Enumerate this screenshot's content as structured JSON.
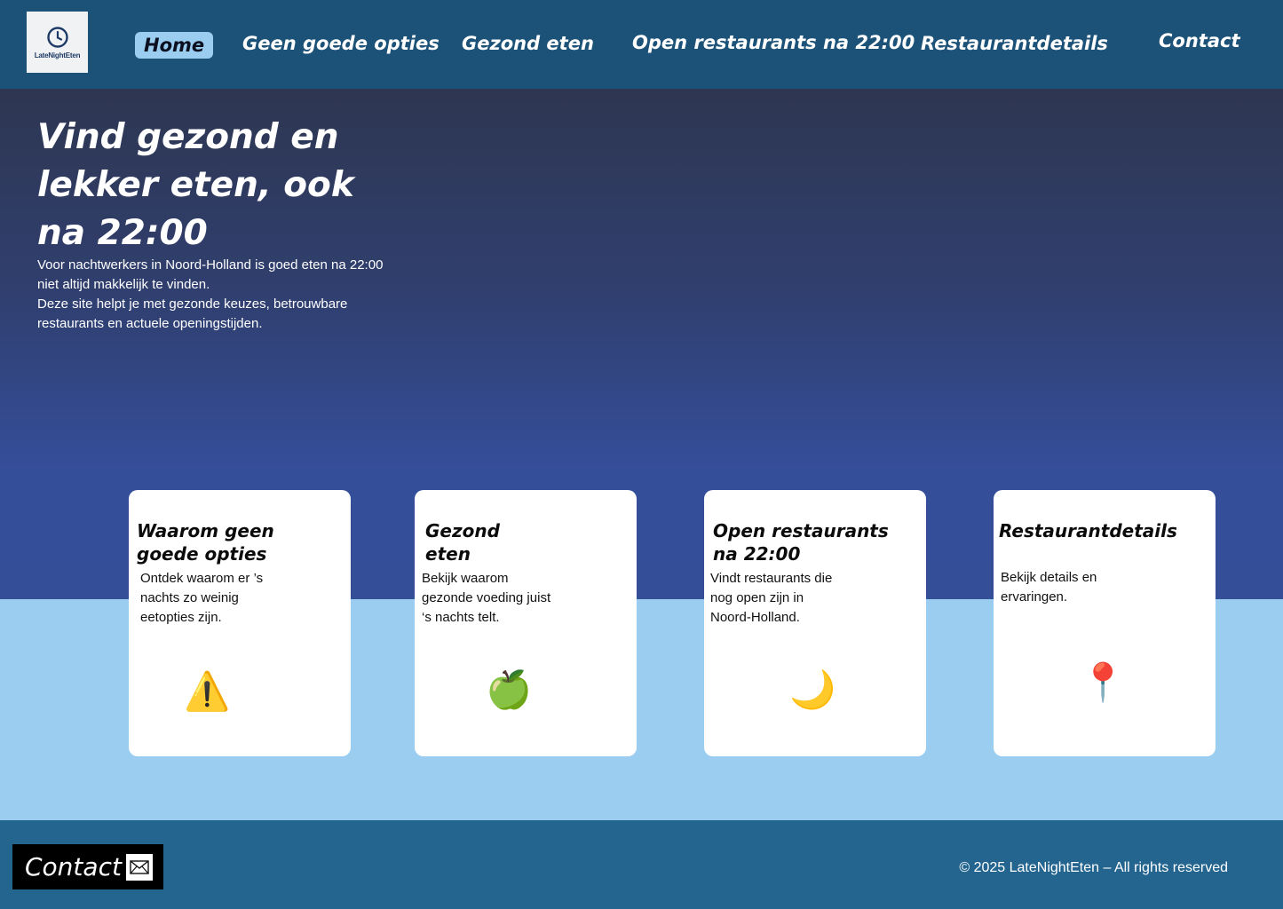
{
  "logo": {
    "text": "LateNightEten",
    "icon": "clock-icon"
  },
  "nav": {
    "home": "Home",
    "geen_goede_opties": "Geen goede opties",
    "gezond_eten": "Gezond eten",
    "open_restaurants": "Open restaurants na 22:00",
    "restaurantdetails": "Restaurantdetails",
    "contact": "Contact"
  },
  "hero": {
    "title": "Vind gezond en lekker eten, ook na 22:00",
    "text_1": "Voor nachtwerkers in Noord-Holland is goed eten na 22:00 niet altijd makkelijk te vinden.",
    "text_2": "Deze site helpt je met gezonde keuzes, betrouwbare restaurants en actuele openingstijden."
  },
  "cards": [
    {
      "title": "Waarom geen goede opties",
      "text": "Ontdek waarom er ’s nachts zo weinig eetopties zijn.",
      "icon": "⚠️",
      "icon_name": "warning-icon"
    },
    {
      "title": "Gezond eten",
      "text": "Bekijk waarom gezonde voeding juist ‘s nachts telt.",
      "icon": "🍏",
      "icon_name": "apple-icon"
    },
    {
      "title": "Open restaurants na 22:00",
      "text": "Vindt restaurants die nog open zijn in Noord-Holland.",
      "icon": "🌙",
      "icon_name": "moon-icon"
    },
    {
      "title": "Restaurantdetails",
      "text": "Bekijk details en ervaringen.",
      "icon": "📍",
      "icon_name": "pin-icon"
    }
  ],
  "footer": {
    "contact_label": "Contact",
    "mail_icon": "mail-icon",
    "copyright": "© 2025 LateNightEten – All rights reserved"
  },
  "colors": {
    "header_bg": "#1c5278",
    "nav_active_bg": "#9bcdf0",
    "hero_top": "#2e3651",
    "hero_bottom": "#344e98",
    "band_light_blue": "#9bcdf0",
    "footer_bg": "#246590"
  }
}
